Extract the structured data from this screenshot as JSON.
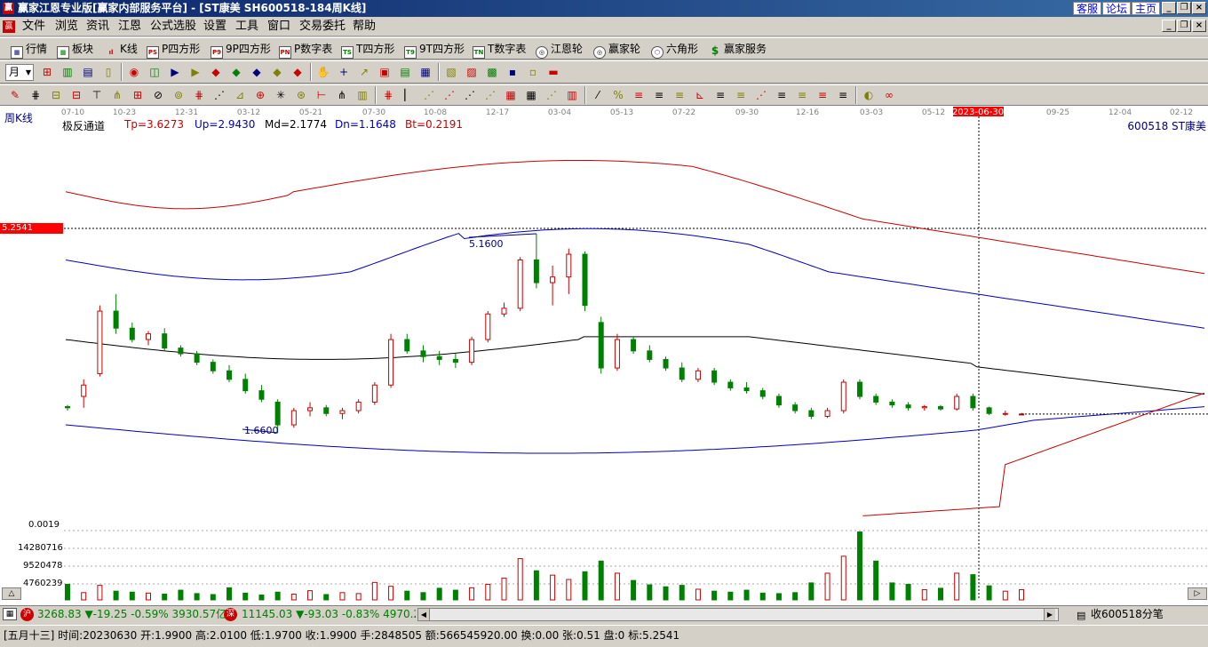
{
  "title": "赢家江恩专业版[赢家内部服务平台] - [ST康美   SH600518-184周K线]",
  "title_buttons": [
    "客服",
    "论坛",
    "主页"
  ],
  "menu": [
    "文件",
    "浏览",
    "资讯",
    "江恩",
    "公式选股",
    "设置",
    "工具",
    "窗口",
    "交易委托",
    "帮助"
  ],
  "toolbar1": [
    "行情",
    "板块",
    "K线",
    "P四方形",
    "9P四方形",
    "P数字表",
    "T四方形",
    "9T四方形",
    "T数字表",
    "江恩轮",
    "赢家轮",
    "六角形",
    "赢家服务"
  ],
  "toolbar1_icons": [
    "PS",
    "P9",
    "PN",
    "TS",
    "T9",
    "TN"
  ],
  "period_label": "月",
  "date_axis": [
    "07-10",
    "10-23",
    "12-31",
    "03-12",
    "05-21",
    "07-30",
    "10-08",
    "12-17",
    "03-04",
    "05-13",
    "07-22",
    "09-30",
    "12-16",
    "03-03",
    "05-12",
    "2023-06-30",
    "09-25",
    "12-04",
    "02-12"
  ],
  "chart_label": "周K线",
  "indicator": {
    "name": "极反通道",
    "tp": "Tp=3.6273",
    "up": "Up=2.9430",
    "md": "Md=2.1774",
    "dn": "Dn=1.1648",
    "bt": "Bt=0.2191"
  },
  "stock_label": "600518 ST康美",
  "cursor_price": "5.2541",
  "hi_label": "5.1600",
  "lo_label": "1.6600",
  "vol_scale": [
    "0.0019",
    "14280716",
    "9520478",
    "4760239"
  ],
  "index_sh": {
    "val": "3268.83",
    "chg": "▼-19.25",
    "pct": "-0.59%",
    "amt": "3930.57亿"
  },
  "index_sz": {
    "val": "11145.03",
    "chg": "▼-93.03",
    "pct": "-0.83%",
    "amt": "4970.2"
  },
  "status_right": "收600518分笔",
  "status_info": "[五月十三] 时间:20230630 开:1.9900 高:2.0100 低:1.9700 收:1.9900 手:2848505 额:566545920.00 换:0.00 张:0.51 盘:0 标:5.2541",
  "colors": {
    "red": "#cc0000",
    "green": "#008000",
    "blue": "#000080",
    "black": "#000000",
    "selection": "#ff0000"
  },
  "icons": [
    "app-logo-icon",
    "minimize-icon",
    "restore-icon",
    "close-icon",
    "grid-icon",
    "stock-block-icon",
    "kline-icon",
    "compass-icon",
    "wheel-icon",
    "hexagon-icon",
    "dollar-icon",
    "hand-icon",
    "crosshair-icon",
    "scroll-left-icon",
    "scroll-right-icon"
  ],
  "chart_data": {
    "type": "candlestick",
    "y_ref": 5.2541,
    "candles": [
      [
        2.12,
        2.15,
        2.05,
        2.1
      ],
      [
        2.3,
        2.6,
        2.1,
        2.5
      ],
      [
        2.7,
        3.9,
        2.65,
        3.8
      ],
      [
        3.8,
        4.1,
        3.4,
        3.5
      ],
      [
        3.5,
        3.6,
        3.25,
        3.3
      ],
      [
        3.3,
        3.45,
        3.2,
        3.4
      ],
      [
        3.4,
        3.5,
        3.1,
        3.15
      ],
      [
        3.15,
        3.2,
        3.0,
        3.05
      ],
      [
        3.05,
        3.1,
        2.85,
        2.9
      ],
      [
        2.9,
        2.95,
        2.7,
        2.75
      ],
      [
        2.75,
        2.85,
        2.55,
        2.6
      ],
      [
        2.6,
        2.7,
        2.35,
        2.4
      ],
      [
        2.4,
        2.5,
        2.2,
        2.25
      ],
      [
        2.2,
        2.25,
        1.66,
        1.8
      ],
      [
        1.8,
        2.1,
        1.75,
        2.05
      ],
      [
        2.05,
        2.2,
        1.95,
        2.1
      ],
      [
        2.1,
        2.15,
        1.95,
        2.0
      ],
      [
        2.0,
        2.1,
        1.9,
        2.05
      ],
      [
        2.05,
        2.25,
        2.0,
        2.2
      ],
      [
        2.2,
        2.55,
        2.15,
        2.5
      ],
      [
        2.5,
        3.4,
        2.45,
        3.3
      ],
      [
        3.3,
        3.4,
        3.05,
        3.1
      ],
      [
        3.1,
        3.2,
        2.9,
        3.0
      ],
      [
        3.0,
        3.1,
        2.85,
        2.95
      ],
      [
        2.95,
        3.05,
        2.8,
        2.9
      ],
      [
        2.9,
        3.35,
        2.85,
        3.3
      ],
      [
        3.3,
        3.8,
        3.25,
        3.75
      ],
      [
        3.75,
        3.95,
        3.7,
        3.85
      ],
      [
        3.85,
        4.75,
        3.8,
        4.7
      ],
      [
        4.7,
        5.16,
        4.2,
        4.3
      ],
      [
        4.3,
        4.6,
        3.9,
        4.4
      ],
      [
        4.4,
        4.9,
        4.1,
        4.8
      ],
      [
        4.8,
        4.85,
        3.8,
        3.9
      ],
      [
        3.6,
        3.7,
        2.7,
        2.8
      ],
      [
        2.8,
        3.4,
        2.75,
        3.3
      ],
      [
        3.3,
        3.35,
        3.05,
        3.1
      ],
      [
        3.1,
        3.2,
        2.9,
        2.95
      ],
      [
        2.95,
        3.0,
        2.75,
        2.8
      ],
      [
        2.8,
        2.9,
        2.55,
        2.6
      ],
      [
        2.6,
        2.8,
        2.55,
        2.75
      ],
      [
        2.75,
        2.8,
        2.5,
        2.55
      ],
      [
        2.55,
        2.6,
        2.4,
        2.45
      ],
      [
        2.45,
        2.55,
        2.35,
        2.4
      ],
      [
        2.4,
        2.45,
        2.25,
        2.3
      ],
      [
        2.3,
        2.35,
        2.1,
        2.15
      ],
      [
        2.15,
        2.2,
        2.0,
        2.05
      ],
      [
        2.05,
        2.1,
        1.9,
        1.95
      ],
      [
        1.95,
        2.1,
        1.92,
        2.05
      ],
      [
        2.05,
        2.6,
        2.0,
        2.55
      ],
      [
        2.55,
        2.6,
        2.25,
        2.3
      ],
      [
        2.3,
        2.35,
        2.15,
        2.2
      ],
      [
        2.2,
        2.25,
        2.1,
        2.15
      ],
      [
        2.15,
        2.2,
        2.05,
        2.1
      ],
      [
        2.1,
        2.15,
        2.05,
        2.12
      ],
      [
        2.12,
        2.15,
        2.05,
        2.08
      ],
      [
        2.08,
        2.35,
        2.05,
        2.3
      ],
      [
        2.3,
        2.35,
        2.05,
        2.1
      ],
      [
        2.1,
        2.12,
        1.97,
        2.0
      ],
      [
        2.0,
        2.05,
        1.96,
        2.0
      ],
      [
        1.99,
        2.01,
        1.97,
        1.99
      ]
    ],
    "volumes": [
      3.2,
      1.5,
      3.0,
      1.8,
      1.6,
      1.4,
      1.2,
      2.0,
      1.3,
      1.1,
      2.5,
      1.4,
      1.0,
      1.6,
      1.2,
      1.9,
      1.1,
      1.5,
      1.3,
      3.6,
      2.8,
      1.8,
      1.5,
      2.4,
      2.0,
      2.5,
      3.2,
      4.5,
      8.5,
      6.0,
      5.1,
      4.2,
      5.8,
      8.0,
      5.5,
      4.0,
      3.1,
      2.7,
      3.0,
      2.2,
      1.8,
      1.6,
      2.0,
      1.4,
      1.3,
      1.5,
      3.5,
      5.5,
      9.0,
      14.0,
      8.0,
      3.5,
      3.2,
      2.1,
      2.4,
      5.5,
      5.2,
      2.9,
      1.8,
      2.1
    ]
  }
}
